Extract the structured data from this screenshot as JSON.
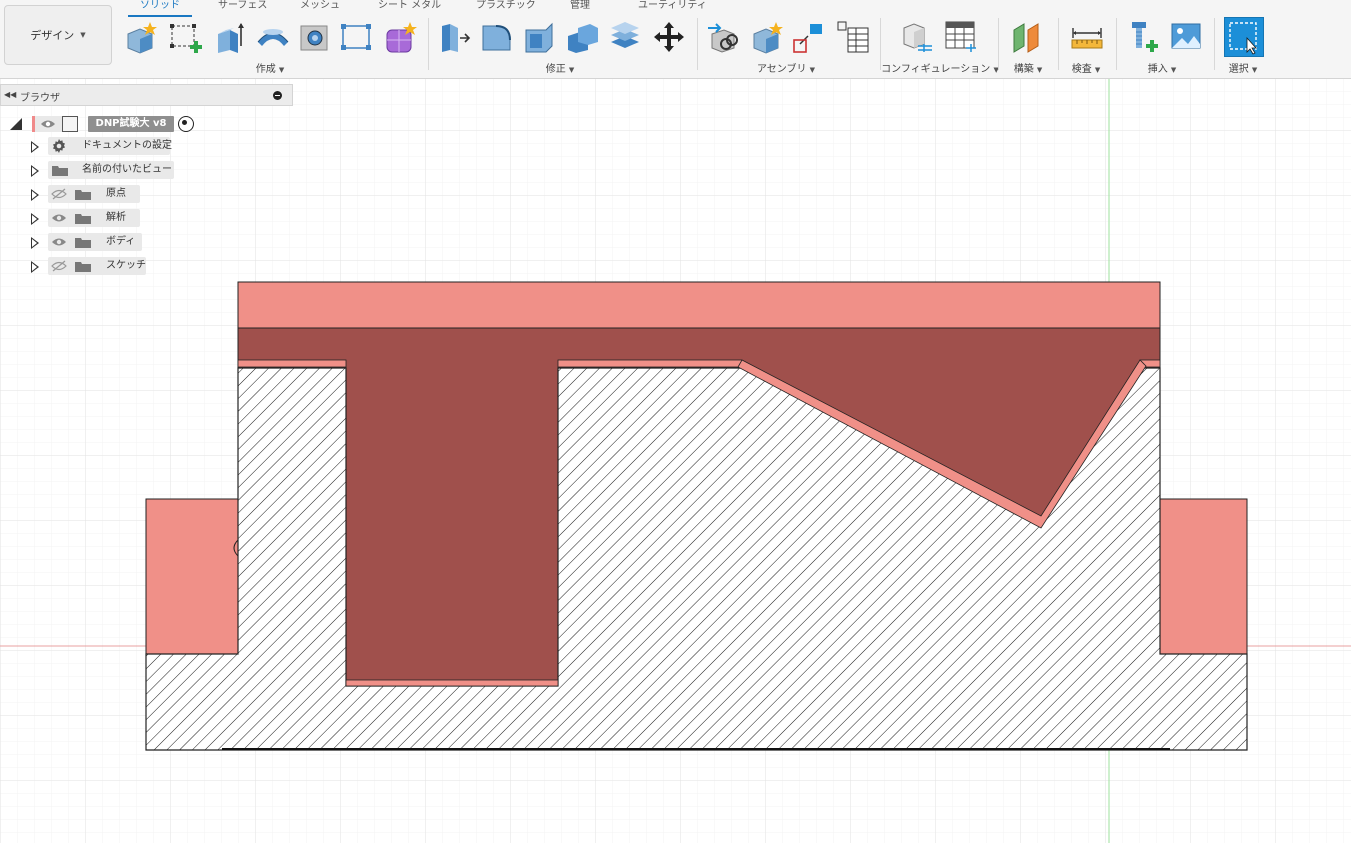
{
  "workspace": {
    "label": "デザイン"
  },
  "tabs": [
    "ソリッド",
    "サーフェス",
    "メッシュ",
    "シート メタル",
    "プラスチック",
    "管理",
    "ユーティリティ"
  ],
  "active_tab": "ソリッド",
  "groups": {
    "create": "作成",
    "modify": "修正",
    "assemble": "アセンブリ",
    "configure": "コンフィギュレーション",
    "construct": "構築",
    "inspect": "検査",
    "insert": "挿入",
    "select": "選択"
  },
  "toolbar_icons": {
    "create": [
      "new-component-icon",
      "create-sketch-icon",
      "extrude-icon",
      "revolve-icon",
      "hole-icon",
      "pattern-icon",
      "create-form-icon"
    ],
    "modify": [
      "press-pull-icon",
      "fillet-icon",
      "shell-icon",
      "combine-icon",
      "offset-face-icon",
      "move-copy-icon"
    ],
    "assemble": [
      "joint-icon",
      "new-component-icon",
      "as-built-joint-icon",
      "bom-icon"
    ],
    "configure": [
      "configure-model-icon",
      "config-table-icon"
    ],
    "construct": [
      "offset-plane-icon"
    ],
    "inspect": [
      "measure-icon"
    ],
    "insert": [
      "insert-derive-icon",
      "insert-canvas-icon"
    ],
    "select": [
      "select-icon"
    ]
  },
  "browser": {
    "title": "ブラウザ",
    "root": {
      "label": "DNP試験大 v8"
    },
    "items": [
      {
        "label": "ドキュメントの設定",
        "icon": "gear-icon"
      },
      {
        "label": "名前の付いたビュー",
        "icon": "folder-icon"
      },
      {
        "label": "原点",
        "icon": "folder-icon",
        "eye": "hidden"
      },
      {
        "label": "解析",
        "icon": "folder-icon",
        "eye": "visible"
      },
      {
        "label": "ボディ",
        "icon": "folder-icon",
        "eye": "visible"
      },
      {
        "label": "スケッチ",
        "icon": "folder-icon",
        "eye": "hidden"
      }
    ]
  },
  "colors": {
    "accent": "#1a78c2",
    "body_light": "#f09088",
    "body_dark": "#a0504c",
    "grid": "#e4e4e4",
    "axis_red": "#e8a0a0",
    "axis_green": "#9ee29e"
  }
}
